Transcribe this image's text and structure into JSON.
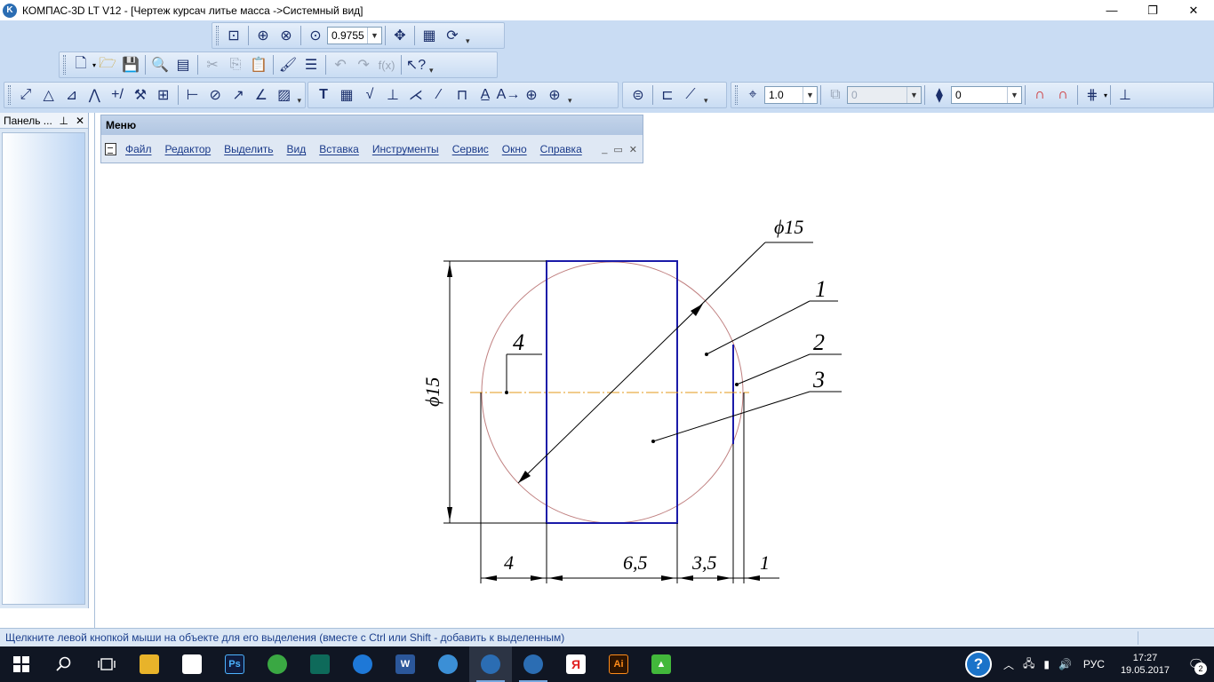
{
  "window": {
    "app_logo": "K",
    "title": "КОМПАС-3D LT V12 - [Чертеж курсач литье масса ->Системный вид]",
    "minimize": "—",
    "restore": "❐",
    "close": "✕"
  },
  "toolbar": {
    "zoom_value": "0.9755",
    "line_scale_value": "1.0",
    "layer_value": "0",
    "style_value": "0",
    "function_label": "f(x)"
  },
  "left_panel": {
    "title": "Панель ...",
    "pin": "⊥",
    "close": "✕"
  },
  "menu_window": {
    "title": "Меню",
    "items": [
      "Файл",
      "Редактор",
      "Выделить",
      "Вид",
      "Вставка",
      "Инструменты",
      "Сервис",
      "Окно",
      "Справка"
    ],
    "ctrl_min": "_",
    "ctrl_restore": "▭",
    "ctrl_close": "✕"
  },
  "drawing": {
    "diameter_callout": "ϕ15",
    "vertical_dim": "ϕ15",
    "leader_labels": [
      "1",
      "2",
      "3",
      "4"
    ],
    "bottom_dims": [
      "4",
      "6,5",
      "3,5",
      "1"
    ],
    "colors": {
      "rect": "#1a1aa8",
      "circle": "#c08080",
      "centerline": "#e39a1a",
      "dim_line": "#000000"
    }
  },
  "statusbar": {
    "hint": "Щелкните левой кнопкой мыши на объекте для его выделения (вместе с Ctrl или Shift - добавить к выделенным)"
  },
  "taskbar": {
    "ps_label": "Ps",
    "word_label": "W",
    "ya_label": "Я",
    "ai_label": "Ai",
    "lang": "РУС",
    "time": "17:27",
    "date": "19.05.2017",
    "notifications": "2",
    "help": "?"
  }
}
